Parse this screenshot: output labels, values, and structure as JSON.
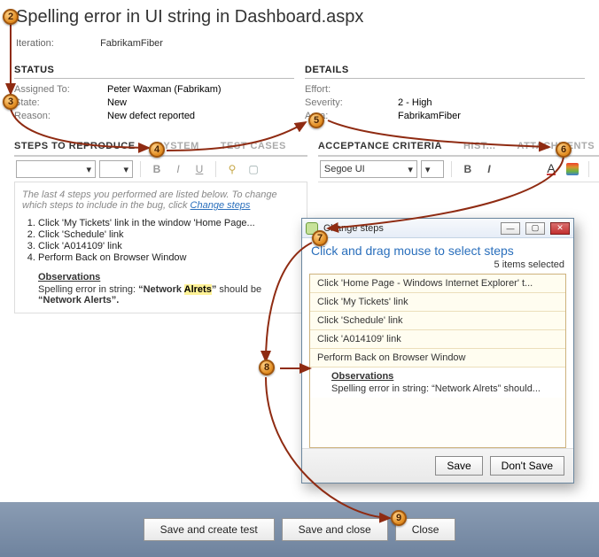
{
  "title": "Spelling error in UI string in Dashboard.aspx",
  "iteration": {
    "label": "Iteration:",
    "value": "FabrikamFiber"
  },
  "status": {
    "heading": "STATUS",
    "assigned_to_label": "Assigned To:",
    "assigned_to_value": "Peter Waxman (Fabrikam)",
    "state_label": "State:",
    "state_value": "New",
    "reason_label": "Reason:",
    "reason_value": "New defect reported"
  },
  "details": {
    "heading": "DETAILS",
    "effort_label": "Effort:",
    "effort_value": "",
    "severity_label": "Severity:",
    "severity_value": "2 - High",
    "area_label": "Area:",
    "area_value": "FabrikamFiber"
  },
  "tabs_left": {
    "steps": "STEPS TO REPRODUCE",
    "system": "SYSTEM",
    "test_cases": "TEST CASES"
  },
  "tabs_right": {
    "acceptance": "ACCEPTANCE CRITERIA",
    "history": "HIST...",
    "attachments": "ATTACHMENTS"
  },
  "toolbar_right": {
    "font_name": "Segoe UI"
  },
  "steps": {
    "hint_prefix": "The last 4 steps you performed are listed below. To change which steps to include in the bug, click ",
    "hint_link": "Change steps",
    "items": [
      "Click 'My Tickets' link in the window 'Home Page...",
      "Click 'Schedule' link",
      "Click 'A014109' link",
      "Perform Back on Browser Window"
    ],
    "obs_head": "Observations",
    "obs_line1_pre": "Spelling error in string: ",
    "obs_line1_q1": "“Network ",
    "obs_line1_hl": "Alrets",
    "obs_line1_q2": "”",
    "obs_line1_post": " should be ",
    "obs_line2": "“Network Alerts”."
  },
  "dialog": {
    "title": "Change steps",
    "subtitle": "Click and drag mouse to select steps",
    "selected_count": "5 items selected",
    "items": [
      "Click 'Home Page - Windows Internet Explorer' t...",
      "Click 'My Tickets' link",
      "Click 'Schedule' link",
      "Click 'A014109' link",
      "Perform Back on Browser Window"
    ],
    "obs_head": "Observations",
    "obs_text": "Spelling error in string: “Network Alrets” should...",
    "save": "Save",
    "dont_save": "Don't Save"
  },
  "bottom": {
    "save_create_test": "Save and create test",
    "save_close": "Save and close",
    "close": "Close"
  },
  "callouts": [
    "2",
    "3",
    "4",
    "5",
    "6",
    "7",
    "8",
    "9"
  ]
}
